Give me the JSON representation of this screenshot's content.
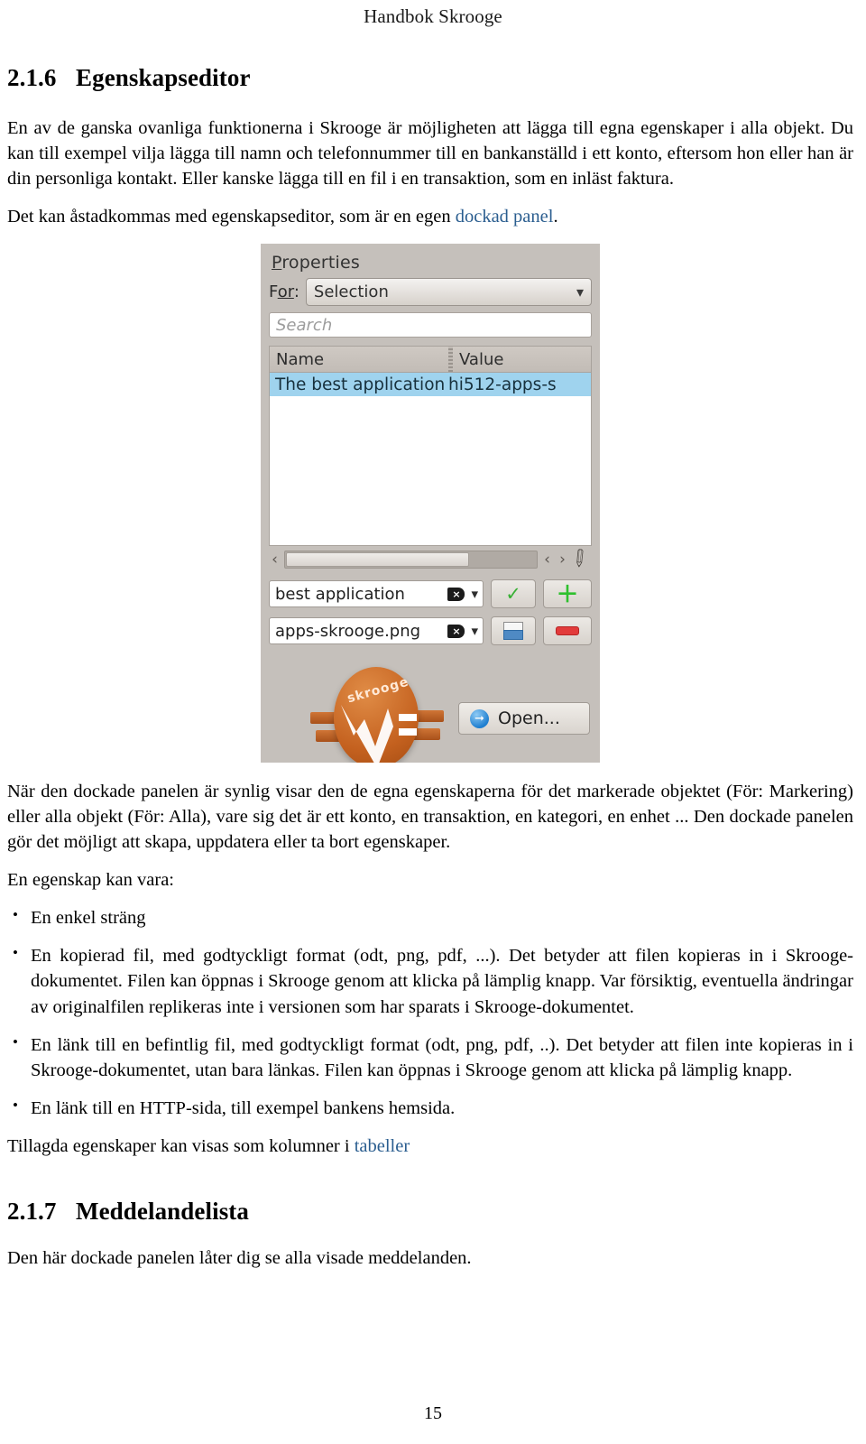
{
  "running_head": "Handbok Skrooge",
  "page_number": "15",
  "sections": {
    "first": {
      "number": "2.1.6",
      "title": "Egenskapseditor",
      "paragraph_1": "En av de ganska ovanliga funktionerna i Skrooge är möjligheten att lägga till egna egenskaper i alla objekt. Du kan till exempel vilja lägga till namn och telefonnummer till en bankanställd i ett konto, eftersom hon eller han är din personliga kontakt. Eller kanske lägga till en fil i en transaktion, som en inläst faktura.",
      "paragraph_2_prefix": "Det kan åstadkommas med egenskapseditor, som är en egen ",
      "paragraph_2_link": "dockad panel",
      "paragraph_2_suffix": ".",
      "paragraph_3": "När den dockade panelen är synlig visar den de egna egenskaperna för det markerade objektet (För: Markering) eller alla objekt (För: Alla), vare sig det är ett konto, en transaktion, en kategori, en enhet ... Den dockade panelen gör det möjligt att skapa, uppdatera eller ta bort egenskaper.",
      "paragraph_4": "En egenskap kan vara:",
      "bullets": [
        "En enkel sträng",
        "En kopierad fil, med godtyckligt format (odt, png, pdf, ...). Det betyder att filen kopieras in i Skrooge-dokumentet. Filen kan öppnas i Skrooge genom att klicka på lämplig knapp. Var försiktig, eventuella ändringar av originalfilen replikeras inte i versionen som har sparats i Skrooge-dokumentet.",
        "En länk till en befintlig fil, med godtyckligt format (odt, png, pdf, ..). Det betyder att filen inte kopieras in i Skrooge-dokumentet, utan bara länkas. Filen kan öppnas i Skrooge genom att klicka på lämplig knapp.",
        "En länk till en HTTP-sida, till exempel bankens hemsida."
      ],
      "closing_prefix": "Tillagda egenskaper kan visas som kolumner i ",
      "closing_link": "tabeller"
    },
    "second": {
      "number": "2.1.7",
      "title": "Meddelandelista",
      "paragraph_1": "Den här dockade panelen låter dig se alla visade meddelanden."
    }
  },
  "figure": {
    "panel_title": "Properties",
    "panel_title_accel": "P",
    "panel_title_rest": "roperties",
    "for_label_pre": "F",
    "for_label_accel": "or",
    "for_label_post": ":",
    "for_value": "Selection",
    "search_placeholder": "Search",
    "table": {
      "columns": [
        "Name",
        "Value"
      ],
      "rows": [
        {
          "name": "The best application",
          "value": "hi512-apps-s"
        }
      ]
    },
    "scroll": {
      "left_arrow": "‹",
      "prev_arrow": "‹",
      "next_arrow": "›",
      "grip_icon": "resize-grip-icon"
    },
    "editor": {
      "name_value": "best application",
      "file_value": "apps-skrooge.png",
      "clear_glyph": "×",
      "chevron_glyph": "⌄",
      "apply_icon": "check-icon",
      "add_icon": "plus-icon",
      "download_icon": "document-icon",
      "remove_icon": "minus-icon"
    },
    "open_button": "Open...",
    "logo_text": "skrooge"
  },
  "colors": {
    "link": "#2a5d8f",
    "panel_bg": "#c5c0bb",
    "selection_row": "#9fd3ee",
    "accent_green": "#2ec02e",
    "accent_red": "#e23b3b",
    "accent_blue": "#1f7fd0",
    "logo_orange": "#c4611f"
  }
}
